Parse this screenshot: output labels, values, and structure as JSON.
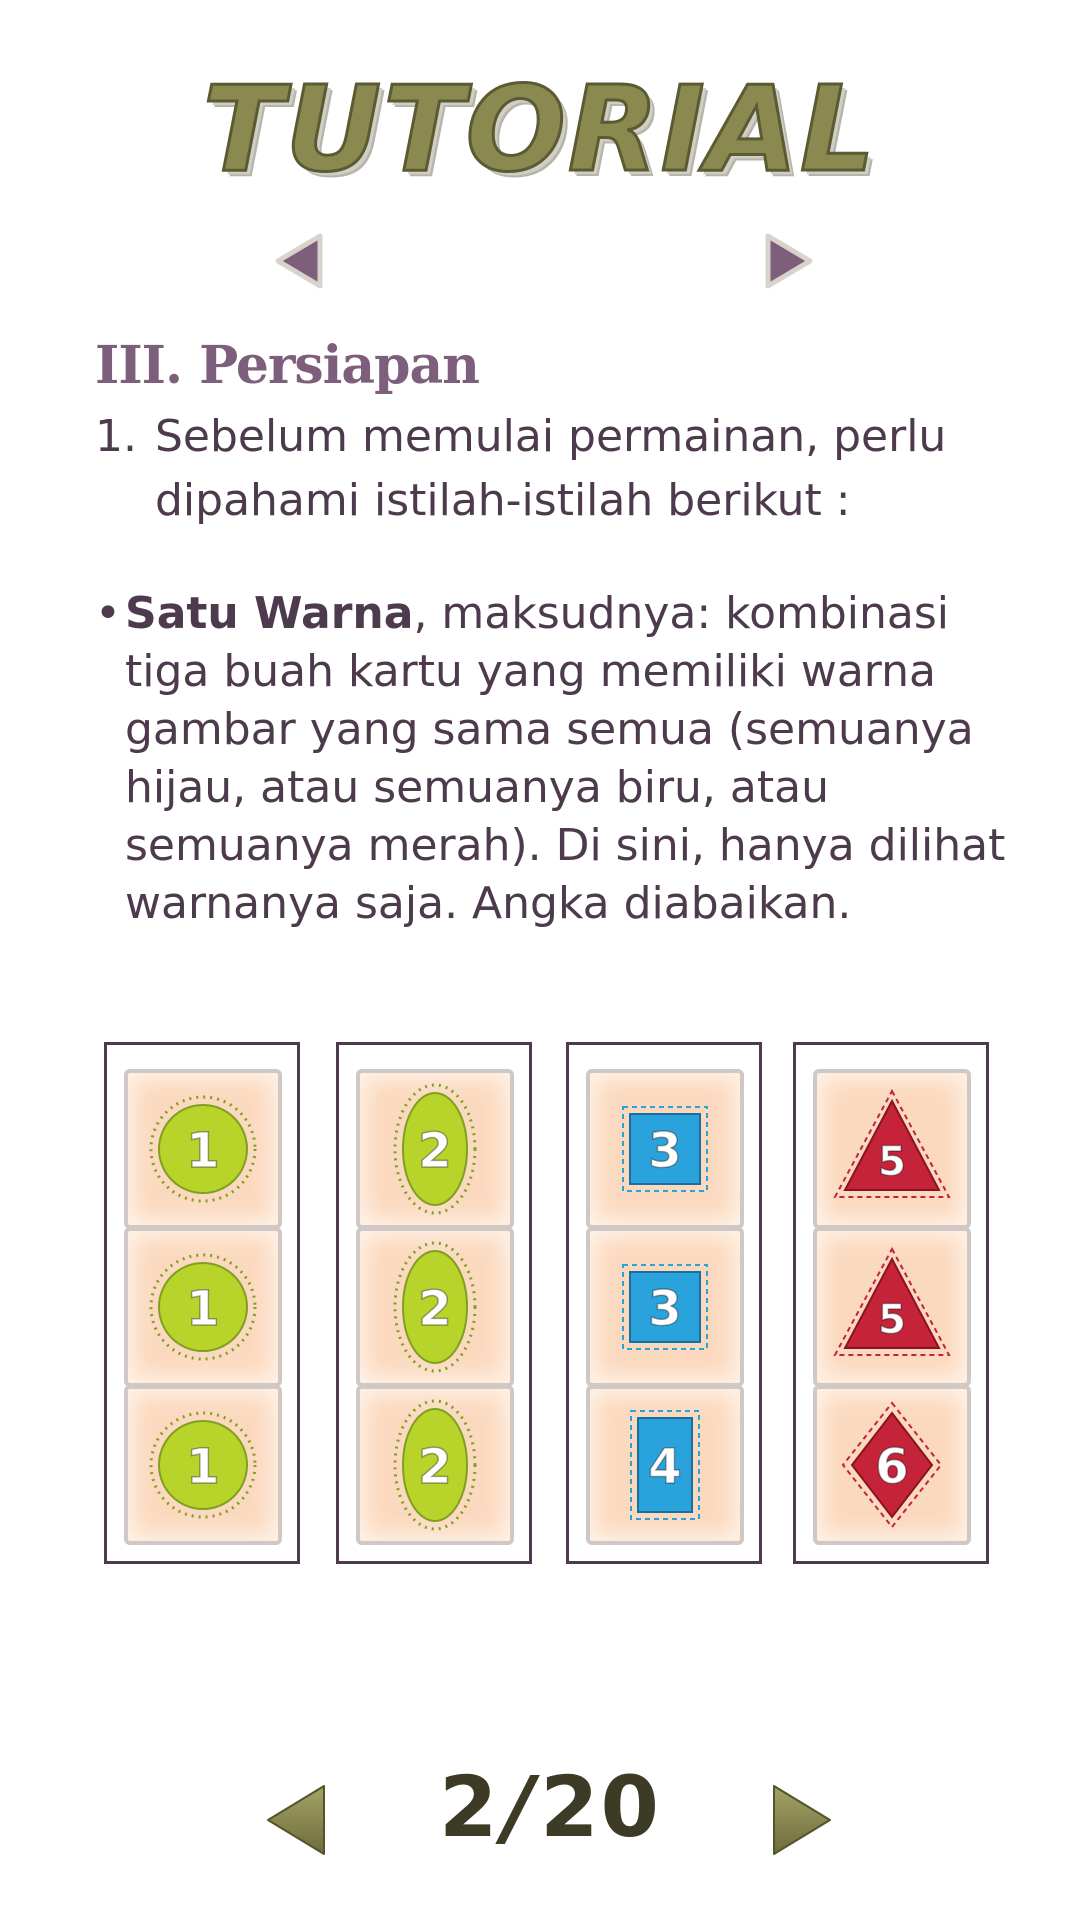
{
  "title": "TUTORIAL",
  "section": {
    "heading": "III. Persiapan",
    "item_number": "1.",
    "item_text": "Sebelum memulai permainan, perlu dipahami istilah-istilah berikut :",
    "bullet": "•",
    "term": "Satu Warna",
    "definition": ", maksudnya: kombinasi tiga buah kartu yang memiliki warna gambar yang sama semua (semuanya hijau, atau semuanya biru, atau semuanya merah). Di sini, hanya dilihat warnanya saja. Angka diabaikan."
  },
  "columns": [
    {
      "cards": [
        {
          "shape": "circle",
          "number": "1",
          "color": "#b8d32a"
        },
        {
          "shape": "circle",
          "number": "1",
          "color": "#b8d32a"
        },
        {
          "shape": "circle",
          "number": "1",
          "color": "#b8d32a"
        }
      ]
    },
    {
      "cards": [
        {
          "shape": "oval",
          "number": "2",
          "color": "#b8d32a"
        },
        {
          "shape": "oval",
          "number": "2",
          "color": "#b8d32a"
        },
        {
          "shape": "oval",
          "number": "2",
          "color": "#b8d32a"
        }
      ]
    },
    {
      "cards": [
        {
          "shape": "square",
          "number": "3",
          "color": "#2aa3dd"
        },
        {
          "shape": "square",
          "number": "3",
          "color": "#2aa3dd"
        },
        {
          "shape": "rectangle",
          "number": "4",
          "color": "#2aa3dd"
        }
      ]
    },
    {
      "cards": [
        {
          "shape": "triangle",
          "number": "5",
          "color": "#c4233a"
        },
        {
          "shape": "triangle",
          "number": "5",
          "color": "#c4233a"
        },
        {
          "shape": "diamond",
          "number": "6",
          "color": "#c4233a"
        }
      ]
    }
  ],
  "pager": {
    "current": "2",
    "separator": "/",
    "total": "20"
  },
  "icons": {
    "top_prev": "triangle-left-icon",
    "top_next": "triangle-right-icon",
    "bottom_prev": "triangle-left-icon",
    "bottom_next": "triangle-right-icon"
  },
  "colors": {
    "text": "#4e3a4d",
    "heading": "#7d5e7b",
    "title": "#8a8a50",
    "card_bg": "#fbd9bf"
  }
}
